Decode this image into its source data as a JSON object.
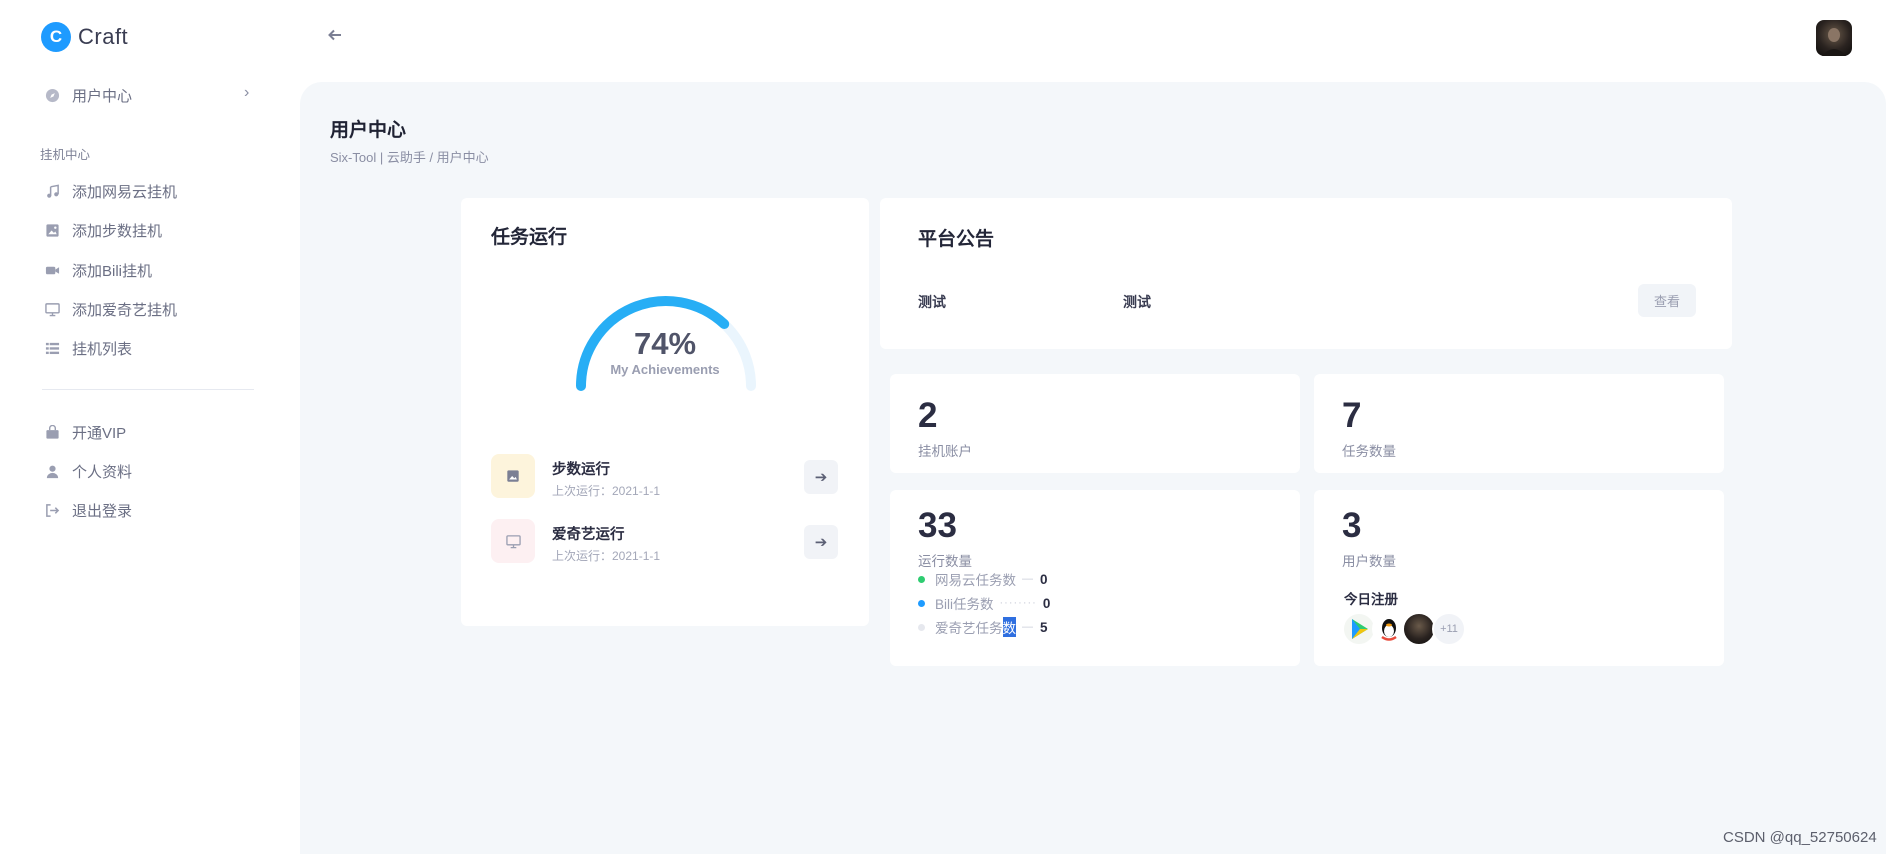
{
  "brand": {
    "logo_letter": "C",
    "name": "Craft",
    "color": "#1e9bff"
  },
  "sidebar": {
    "user_center": "用户中心",
    "section": "挂机中心",
    "items": [
      {
        "label": "添加网易云挂机",
        "icon": "music-icon"
      },
      {
        "label": "添加步数挂机",
        "icon": "image-icon"
      },
      {
        "label": "添加Bili挂机",
        "icon": "video-icon"
      },
      {
        "label": "添加爱奇艺挂机",
        "icon": "monitor-icon"
      },
      {
        "label": "挂机列表",
        "icon": "list-icon"
      }
    ],
    "bottom_items": [
      {
        "label": "开通VIP",
        "icon": "bag-icon"
      },
      {
        "label": "个人资料",
        "icon": "user-icon"
      },
      {
        "label": "退出登录",
        "icon": "logout-icon"
      }
    ]
  },
  "page": {
    "title": "用户中心",
    "breadcrumb": "Six-Tool | 云助手  /  用户中心"
  },
  "task_card": {
    "title": "任务运行",
    "progress": 0.74,
    "percent_label": "74%",
    "gauge_caption": "My Achievements",
    "gauge_color": "#27aef5",
    "tasks": [
      {
        "name": "步数运行",
        "last_run": "上次运行：2021-1-1",
        "icon": "image-icon",
        "bg": "#fdf4dc"
      },
      {
        "name": "爱奇艺运行",
        "last_run": "上次运行：2021-1-1",
        "icon": "monitor-icon",
        "bg": "#fdf0f2"
      }
    ]
  },
  "notice_card": {
    "title": "平台公告",
    "items": [
      "测试",
      "测试"
    ],
    "view_button": "查看"
  },
  "stats": {
    "accounts": {
      "value": "2",
      "label": "挂机账户"
    },
    "tasks": {
      "value": "7",
      "label": "任务数量"
    },
    "runs": {
      "value": "33",
      "label": "运行数量",
      "breakdown": [
        {
          "label": "网易云任务数",
          "value": "0",
          "color": "#2ecc71"
        },
        {
          "label": "Bili任务数",
          "value": "0",
          "color": "#1e9bff"
        },
        {
          "label": "爱奇艺任务",
          "label_selected": "数",
          "value": "5",
          "color": "#e6e8ee"
        }
      ]
    },
    "users": {
      "value": "3",
      "label": "用户数量",
      "today_title": "今日注册",
      "more_count": "+11"
    }
  },
  "watermark": "CSDN @qq_52750624"
}
